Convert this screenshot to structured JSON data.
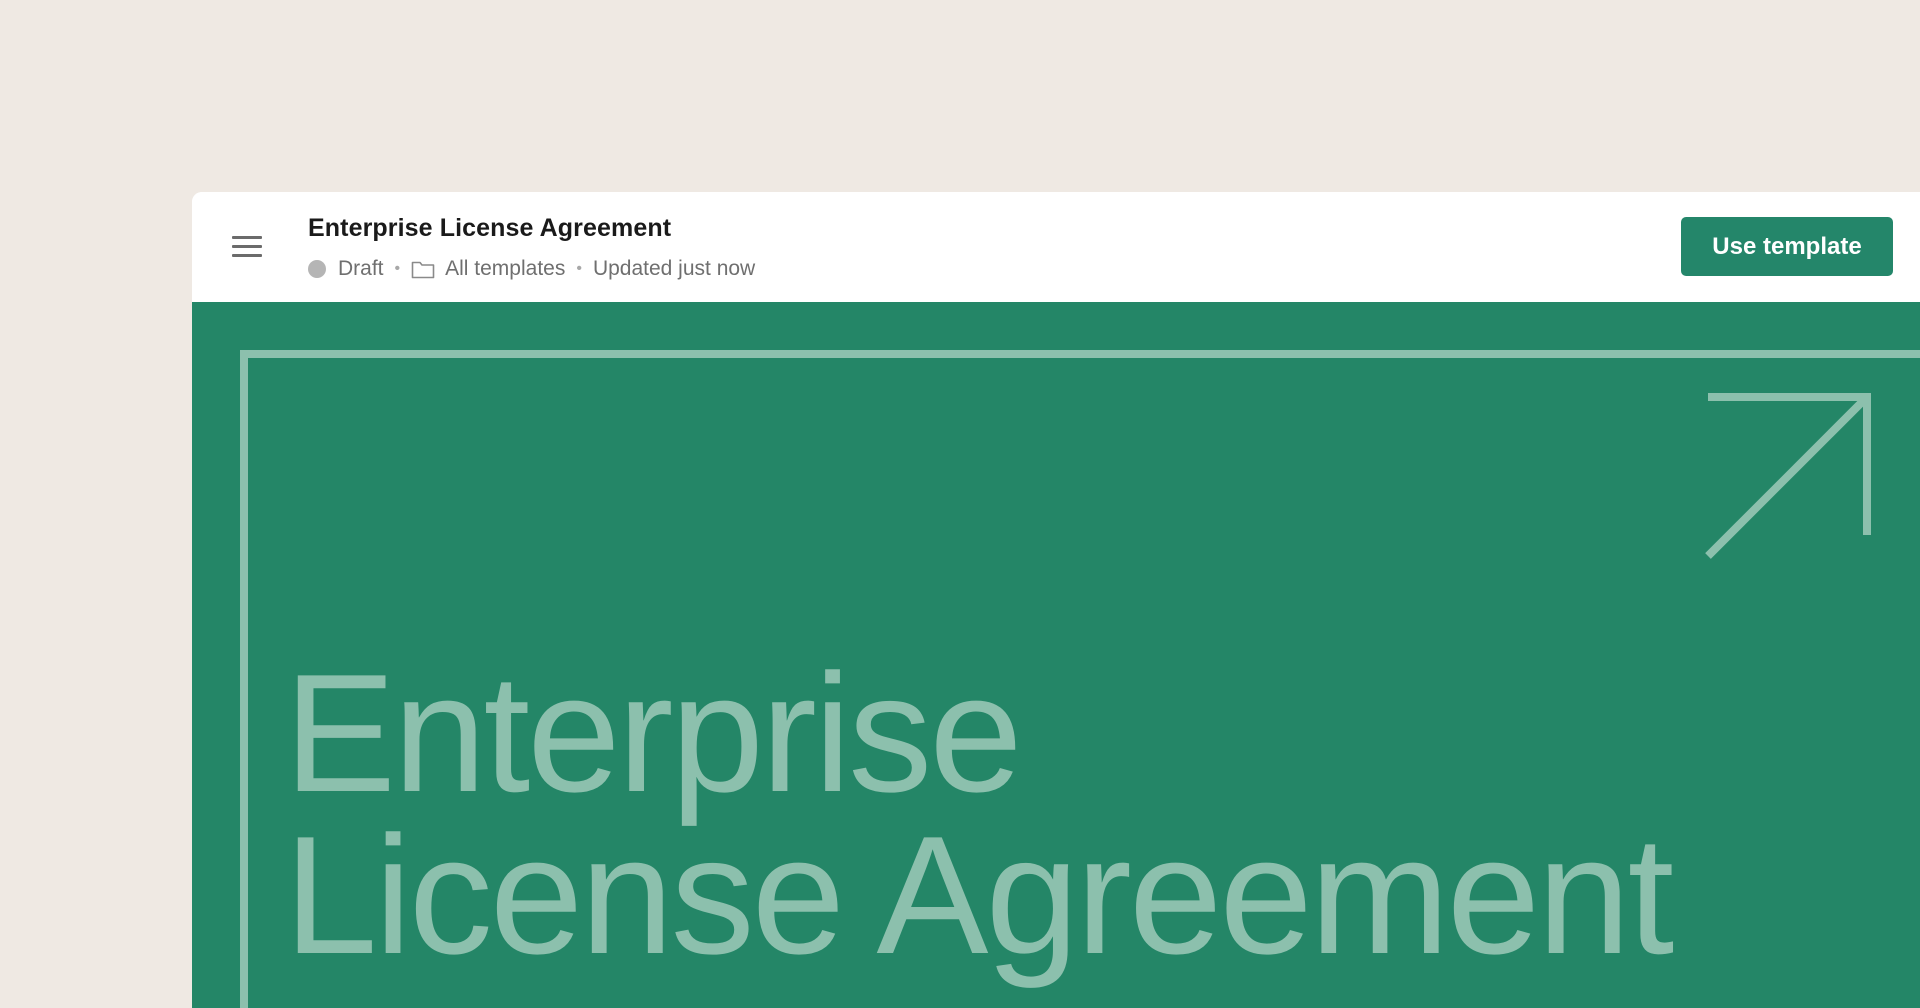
{
  "document": {
    "title": "Enterprise License Agreement",
    "status": "Draft",
    "folder": "All templates",
    "updated": "Updated just now"
  },
  "actions": {
    "use_template_label": "Use template"
  },
  "preview": {
    "cover_title_line1": "Enterprise",
    "cover_title_line2": "License Agreement"
  },
  "icons": {
    "menu": "hamburger-menu-icon",
    "status": "status-dot-icon",
    "folder": "folder-icon",
    "arrow": "arrow-up-right-icon"
  },
  "colors": {
    "background": "#efe9e3",
    "brand_green": "#24866a",
    "cover_green": "#248667",
    "cover_accent": "#8cc0ad",
    "status_gray": "#b5b5b5"
  }
}
